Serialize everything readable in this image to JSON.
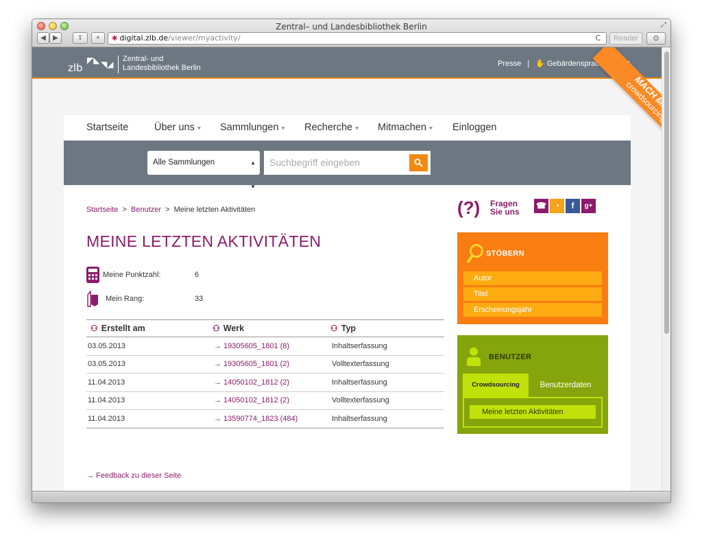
{
  "window": {
    "title": "Zentral– und Landesbibliothek Berlin"
  },
  "browser": {
    "url_domain": "digital.zlb.de",
    "url_path": "/viewer/myactivity/",
    "reader_label": "Reader",
    "back_label": "◀",
    "forward_label": "▶",
    "share_label": "⇪",
    "newtab_label": "+",
    "reload_label": "C",
    "download_label": "⊙",
    "fullscreen_label": "⤢"
  },
  "header": {
    "logo_mark": "zlb",
    "logo_line1": "Zentral- und",
    "logo_line2": "Landesbibliothek Berlin",
    "links": [
      {
        "label": "Presse"
      },
      {
        "label": "Gebärdensprache"
      }
    ],
    "separator": "|"
  },
  "banner": {
    "line1": "MACH MIT!",
    "line2": "crowdsourcing"
  },
  "nav": {
    "items": [
      {
        "label": "Startseite",
        "dropdown": false
      },
      {
        "label": "Über uns",
        "dropdown": true
      },
      {
        "label": "Sammlungen",
        "dropdown": true
      },
      {
        "label": "Recherche",
        "dropdown": true
      },
      {
        "label": "Mitmachen",
        "dropdown": true
      },
      {
        "label": "Einloggen",
        "dropdown": false
      }
    ],
    "dropdown_glyph": "▾"
  },
  "search": {
    "collection_selected": "Alle Sammlungen",
    "placeholder": "Suchbegriff eingeben",
    "button_icon": "search-icon"
  },
  "breadcrumb": {
    "items": [
      "Startseite",
      "Benutzer",
      "Meine letzten Aktivitäten"
    ],
    "separator": ">"
  },
  "page": {
    "title": "MEINE LETZTEN AKTIVITÄTEN"
  },
  "stats": {
    "score_label": "Meine Punktzahl:",
    "score_value": "6",
    "rank_label": "Mein Rang:",
    "rank_value": "33"
  },
  "table": {
    "headers": [
      "Erstellt am",
      "Werk",
      "Typ"
    ],
    "rows": [
      {
        "date": "03.05.2013",
        "werk": "→ 19305605_1801 (8)",
        "typ": "Inhaltserfassung"
      },
      {
        "date": "03.05.2013",
        "werk": "→ 19305605_1801 (2)",
        "typ": "Volltexterfassung"
      },
      {
        "date": "11.04.2013",
        "werk": "→ 14050102_1812 (2)",
        "typ": "Inhaltserfassung"
      },
      {
        "date": "11.04.2013",
        "werk": "→ 14050102_1812 (2)",
        "typ": "Volltexterfassung"
      },
      {
        "date": "11.04.2013",
        "werk": "→ 13590774_1823 (484)",
        "typ": "Inhaltserfassung"
      }
    ]
  },
  "feedback": {
    "label": "→ Feedback zu dieser Seite"
  },
  "help": {
    "line1": "Fragen",
    "line2": "Sie uns"
  },
  "social": {
    "facebook_label": "f",
    "googleplus_label": "g+"
  },
  "stoebern": {
    "title": "STÖBERN",
    "links": [
      "Autor",
      "Titel",
      "Erscheinungsjahr"
    ]
  },
  "benutzer": {
    "title": "BENUTZER",
    "tabs": [
      "Crowdsourcing",
      "Benutzerdaten"
    ],
    "active_item": "Meine letzten Aktivitäten"
  },
  "colors": {
    "accent": "#8d1a6b",
    "orange": "#f97d10",
    "green": "#86a40c",
    "slate": "#6d7782"
  }
}
